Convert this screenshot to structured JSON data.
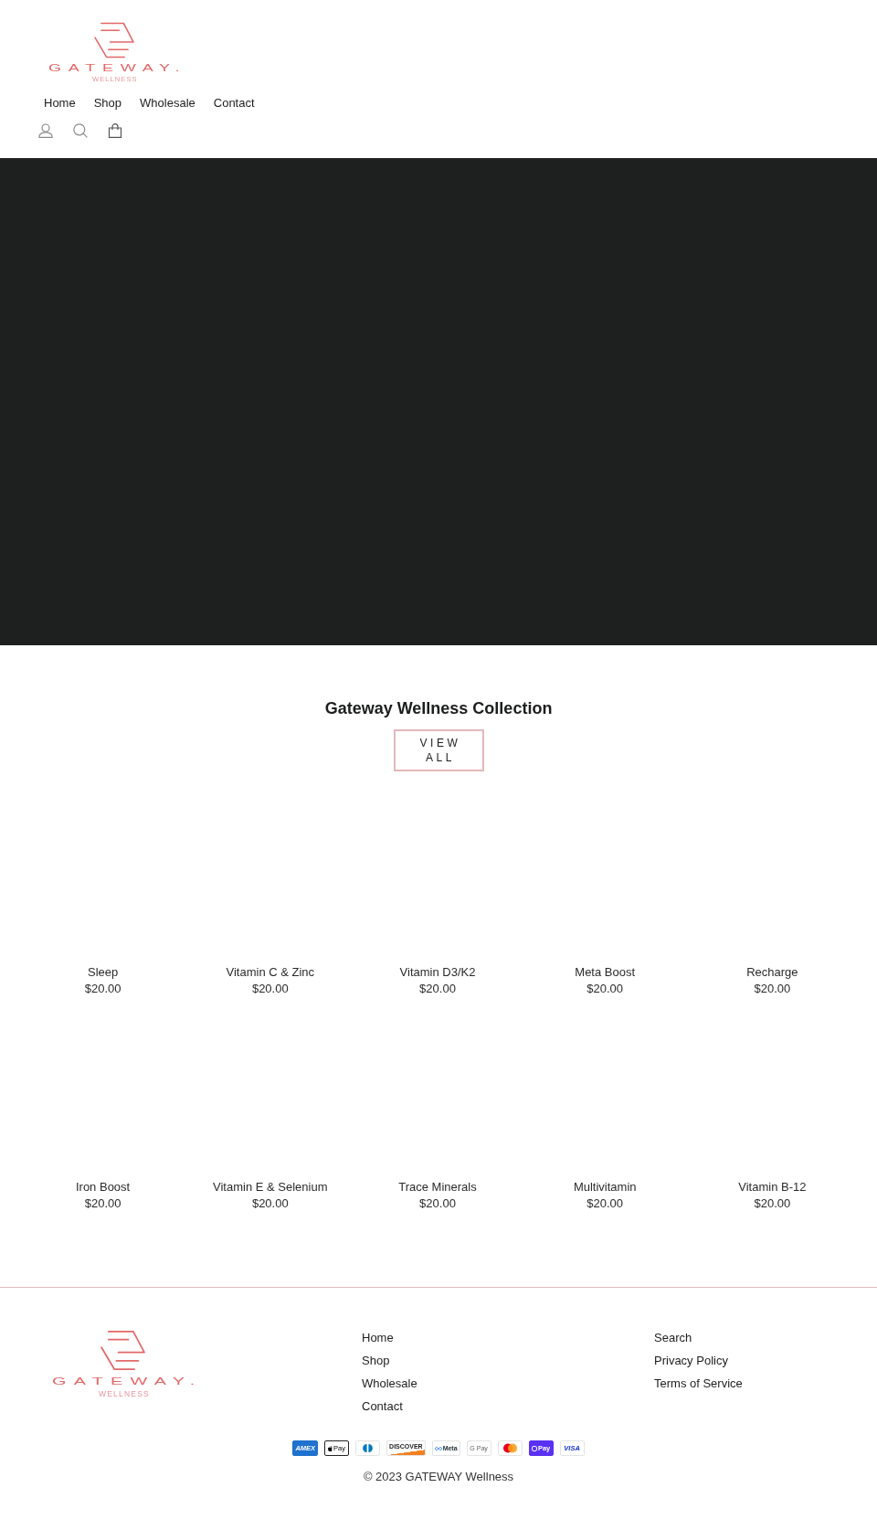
{
  "header": {
    "logo": {
      "wordmark": "GATEWAY.",
      "tagline": "WELLNESS"
    },
    "nav": [
      {
        "label": "Home"
      },
      {
        "label": "Shop"
      },
      {
        "label": "Wholesale"
      },
      {
        "label": "Contact"
      }
    ]
  },
  "collection": {
    "title": "Gateway Wellness Collection",
    "button": "VIEW ALL",
    "products": [
      {
        "name": "Sleep",
        "price": "$20.00"
      },
      {
        "name": "Vitamin C & Zinc",
        "price": "$20.00"
      },
      {
        "name": "Vitamin D3/K2",
        "price": "$20.00"
      },
      {
        "name": "Meta Boost",
        "price": "$20.00"
      },
      {
        "name": "Recharge",
        "price": "$20.00"
      },
      {
        "name": "Iron Boost",
        "price": "$20.00"
      },
      {
        "name": "Vitamin E & Selenium",
        "price": "$20.00"
      },
      {
        "name": "Trace Minerals",
        "price": "$20.00"
      },
      {
        "name": "Multivitamin",
        "price": "$20.00"
      },
      {
        "name": "Vitamin B-12",
        "price": "$20.00"
      }
    ]
  },
  "footer": {
    "logo": {
      "wordmark": "GATEWAY.",
      "tagline": "WELLNESS"
    },
    "menu_1": [
      {
        "label": "Home"
      },
      {
        "label": "Shop"
      },
      {
        "label": "Wholesale"
      },
      {
        "label": "Contact"
      }
    ],
    "menu_2": [
      {
        "label": "Search"
      },
      {
        "label": "Privacy Policy"
      },
      {
        "label": "Terms of Service"
      }
    ],
    "payment_methods": [
      {
        "kind": "amex",
        "label": "AMEX"
      },
      {
        "kind": "applepay",
        "label": "Pay"
      },
      {
        "kind": "diners"
      },
      {
        "kind": "discover",
        "label": "DISCOVER"
      },
      {
        "kind": "meta",
        "label": "Meta"
      },
      {
        "kind": "gpay",
        "label": "G Pay"
      },
      {
        "kind": "mastercard"
      },
      {
        "kind": "shoppay",
        "label": "Pay"
      },
      {
        "kind": "visa",
        "label": "VISA"
      }
    ],
    "copyright": "© 2023 GATEWAY Wellness"
  }
}
